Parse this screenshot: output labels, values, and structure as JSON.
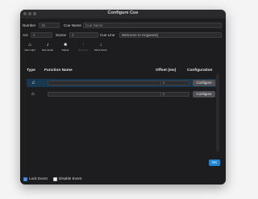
{
  "window": {
    "title": "Configure Cue"
  },
  "fields": {
    "number_label": "Number",
    "number_value": "15",
    "cue_name_label": "Cue Name",
    "cue_name_placeholder": "Cue Name",
    "act_label": "Act",
    "act_value": "2",
    "scene_label": "Scene",
    "scene_value": "3",
    "cue_line_label": "Cue Line",
    "cue_line_value": "Welcome to Hogwarts|"
  },
  "toolbar": [
    {
      "label": "New Light",
      "icon": "light-icon",
      "glyph": "⌂"
    },
    {
      "label": "New Audio",
      "icon": "music-note-icon",
      "glyph": "♪"
    },
    {
      "label": "Delete",
      "icon": "trash-icon",
      "glyph": "■"
    },
    {
      "label": "Move Up",
      "icon": "arrow-up-icon",
      "glyph": "↑"
    },
    {
      "label": "Move Down",
      "icon": "arrow-down-icon",
      "glyph": "↓"
    }
  ],
  "table": {
    "headers": {
      "type": "Type",
      "function_name": "Function Name",
      "offset": "Offset (ms)",
      "configuration": "Configuration"
    },
    "rows": [
      {
        "type_icon": "music-note-icon",
        "glyph": "♫",
        "function_name": "",
        "offset": "0",
        "config_label": "Configure",
        "selected": true
      },
      {
        "type_icon": "light-icon",
        "glyph": "⌂",
        "function_name": "",
        "offset": "0",
        "config_label": "Configure",
        "selected": false
      }
    ]
  },
  "buttons": {
    "ok": "OK"
  },
  "footer": {
    "lock_event_label": "Lock Event",
    "lock_event_checked": true,
    "disable_event_label": "Disable Event",
    "disable_event_checked": false
  },
  "colors": {
    "accent": "#1e88d6",
    "selected_row": "#17384f"
  }
}
